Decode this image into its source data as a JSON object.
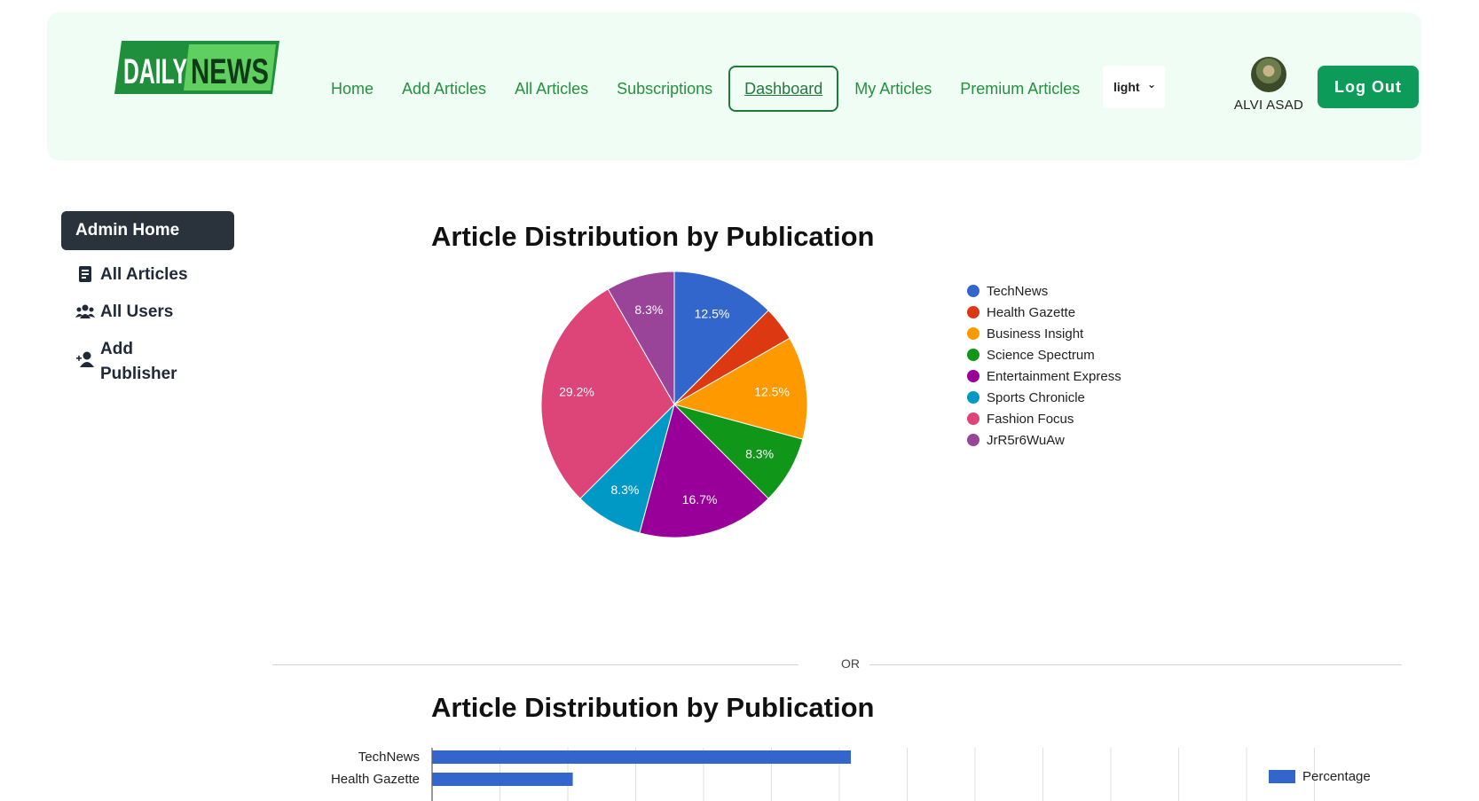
{
  "logo": {
    "left": "DAILY",
    "right": "NEWS"
  },
  "nav": {
    "items": [
      "Home",
      "Add Articles",
      "All Articles",
      "Subscriptions",
      "Dashboard",
      "My Articles",
      "Premium Articles"
    ],
    "active": "Dashboard",
    "theme_value": "light",
    "user_name": "ALVI ASAD",
    "logout_label": "Log Out"
  },
  "sidebar": {
    "home_label": "Admin Home",
    "items": [
      {
        "label": "All Articles",
        "icon": "article-icon"
      },
      {
        "label": "All Users",
        "icon": "users-icon"
      },
      {
        "label": "Add Publisher",
        "icon": "add-user-icon"
      }
    ]
  },
  "divider_label": "OR",
  "chart_data": [
    {
      "type": "pie",
      "title": "Article Distribution by Publication",
      "categories": [
        "TechNews",
        "Health Gazette",
        "Business Insight",
        "Science Spectrum",
        "Entertainment Express",
        "Sports Chronicle",
        "Fashion Focus",
        "JrR5r6WuAw"
      ],
      "values": [
        12.5,
        4.2,
        12.5,
        8.3,
        16.7,
        8.3,
        29.2,
        8.3
      ],
      "labels": [
        "12.5%",
        "",
        "12.5%",
        "8.3%",
        "16.7%",
        "8.3%",
        "29.2%",
        "8.3%"
      ],
      "colors": [
        "#3366cc",
        "#dc3912",
        "#ff9900",
        "#109618",
        "#990099",
        "#0099c6",
        "#dd4477",
        "#994499"
      ],
      "legend": "right"
    },
    {
      "type": "bar",
      "orientation": "horizontal",
      "title": "Article Distribution by Publication",
      "categories": [
        "TechNews",
        "Health Gazette"
      ],
      "series": [
        {
          "name": "Percentage",
          "values": [
            12.5,
            4.2
          ]
        }
      ],
      "xlim": [
        0,
        31.25
      ],
      "color": "#3366cc",
      "legend": "top-right"
    }
  ]
}
